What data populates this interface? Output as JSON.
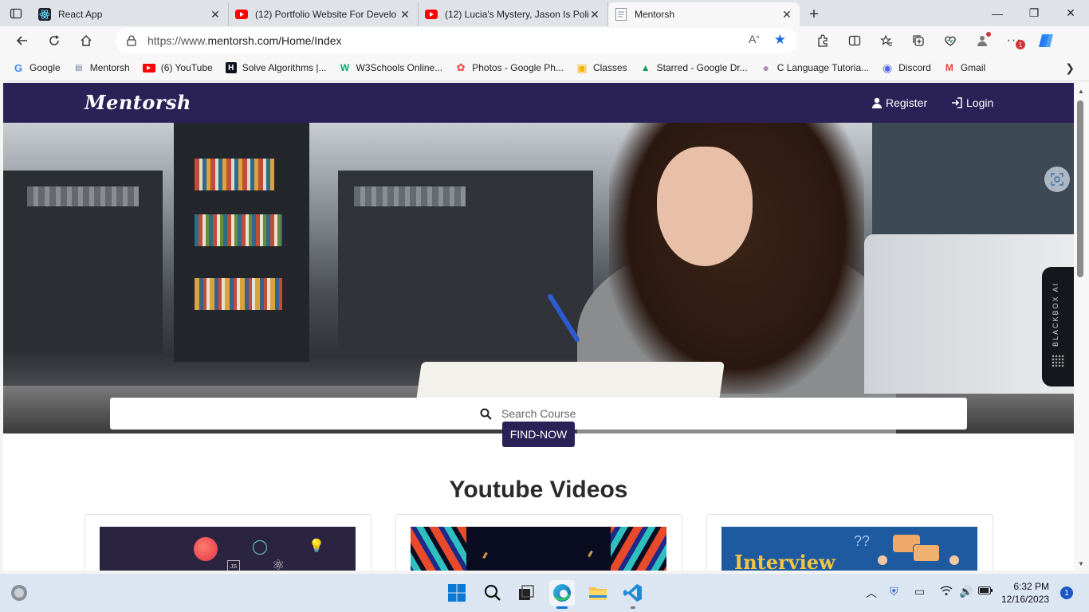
{
  "browser": {
    "tabs": [
      {
        "title": "React App",
        "icon": "react-icon",
        "active": false
      },
      {
        "title": "(12) Portfolio Website For Develo",
        "icon": "youtube-icon",
        "active": false
      },
      {
        "title": "(12) Lucia's Mystery, Jason Is Poli",
        "icon": "youtube-icon",
        "active": false
      },
      {
        "title": "Mentorsh",
        "icon": "page-icon",
        "active": true
      }
    ],
    "url_prefix": "https://www.",
    "url_main": "mentorsh.com/Home/Index",
    "profile_badge": "1",
    "bookmarks": [
      {
        "label": "Google",
        "icon": "G",
        "color": "#4285f4"
      },
      {
        "label": "Mentorsh",
        "icon": "▤",
        "color": "#6a7b99"
      },
      {
        "label": "(6) YouTube",
        "icon": "▶",
        "color": "#ff0000"
      },
      {
        "label": "Solve Algorithms |...",
        "icon": "H",
        "color": "#0e141e"
      },
      {
        "label": "W3Schools Online...",
        "icon": "W",
        "color": "#04aa6d"
      },
      {
        "label": "Photos - Google Ph...",
        "icon": "✿",
        "color": "#ea4335"
      },
      {
        "label": "Classes",
        "icon": "▣",
        "color": "#f4b400"
      },
      {
        "label": "Starred - Google Dr...",
        "icon": "▲",
        "color": "#0f9d58"
      },
      {
        "label": "C Language Tutoria...",
        "icon": "●",
        "color": "#b38cb4"
      },
      {
        "label": "Discord",
        "icon": "◉",
        "color": "#5865f2"
      },
      {
        "label": "Gmail",
        "icon": "M",
        "color": "#ea4335"
      }
    ]
  },
  "site": {
    "brand": "Mentorsh",
    "nav": {
      "register": "Register",
      "login": "Login"
    },
    "search_placeholder": "Search Course",
    "find_button": "FIND-NOW",
    "section_title": "Youtube Videos",
    "thumb3_text": "Interview",
    "blackbox_label": "BLACKBOX AI",
    "colors": {
      "primary": "#2a2257"
    }
  },
  "taskbar": {
    "time": "6:32 PM",
    "date": "12/16/2023",
    "notification_count": "1"
  }
}
